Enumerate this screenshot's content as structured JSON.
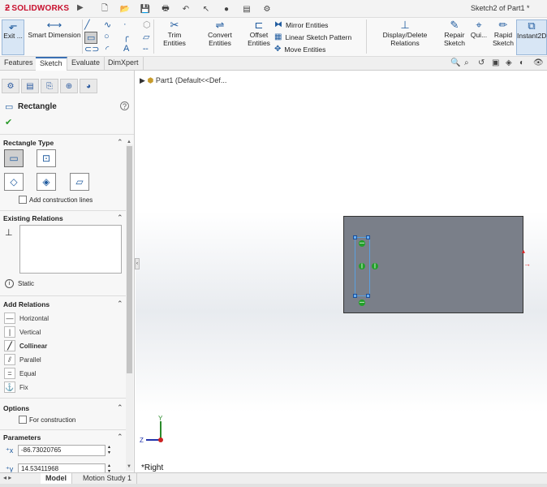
{
  "app": {
    "logo_text": "SOLIDWORKS",
    "doc_title": "Sketch2 of Part1 *"
  },
  "commands": {
    "exit": "Exit ...",
    "smart_dimension": "Smart Dimension",
    "trim": "Trim Entities",
    "convert": "Convert Entities",
    "offset_line1": "Offset",
    "offset_line2": "Entities",
    "mirror": "Mirror Entities",
    "linear_pattern": "Linear Sketch Pattern",
    "move": "Move Entities",
    "display_delete": "Display/Delete Relations",
    "repair_line1": "Repair",
    "repair_line2": "Sketch",
    "quick": "Qui...",
    "rapid_line1": "Rapid",
    "rapid_line2": "Sketch",
    "instant2d": "Instant2D"
  },
  "tabs": [
    "Features",
    "Sketch",
    "Evaluate",
    "DimXpert"
  ],
  "active_tab": "Sketch",
  "panel": {
    "title": "Rectangle",
    "rect_type_title": "Rectangle Type",
    "add_construction": "Add construction lines",
    "existing_relations_title": "Existing Relations",
    "static_label": "Static",
    "add_relations_title": "Add Relations",
    "relations": [
      "Horizontal",
      "Vertical",
      "Collinear",
      "Parallel",
      "Equal",
      "Fix"
    ],
    "options_title": "Options",
    "for_construction": "For construction",
    "parameters_title": "Parameters",
    "param_x": "-86.73020765",
    "param_y": "14.53411968"
  },
  "tree": {
    "root": "Part1  (Default<<Def..."
  },
  "view_label": "*Right",
  "bottom_tabs": [
    "Model",
    "Motion Study 1"
  ],
  "colors": {
    "accent": "#1e5a9e",
    "plane": "#7a7f89",
    "relation": "#23a02a",
    "sketch": "#5aa0e0"
  }
}
